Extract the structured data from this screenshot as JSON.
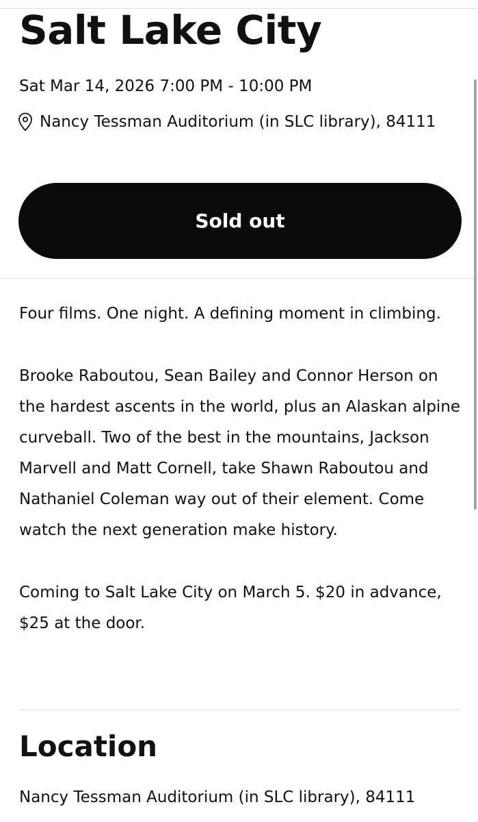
{
  "event": {
    "title": "Salt Lake City",
    "datetime": "Sat Mar 14, 2026 7:00 PM - 10:00 PM",
    "venue": "Nancy Tessman Auditorium (in SLC library), 84111",
    "venue_icon": "location-pin-icon",
    "status_button_label": "Sold out"
  },
  "description": {
    "paragraphs": [
      "Four films. One night. A defining moment in climbing.",
      "Brooke Raboutou, Sean Bailey and Connor Herson on the hardest ascents in the world, plus an Alaskan alpine curveball. Two of the best in the mountains, Jackson Marvell and Matt Cornell, take Shawn Raboutou and Nathaniel Coleman way out of their element. Come watch the next generation make history.",
      "Coming to Salt Lake City on March 5. $20 in advance, $25 at the door."
    ]
  },
  "location": {
    "heading": "Location",
    "address": "Nancy Tessman Auditorium (in SLC library), 84111"
  },
  "colors": {
    "button_background": "#0b0b0b",
    "button_text": "#ffffff",
    "text": "#111111",
    "divider": "#dcdcdc"
  }
}
